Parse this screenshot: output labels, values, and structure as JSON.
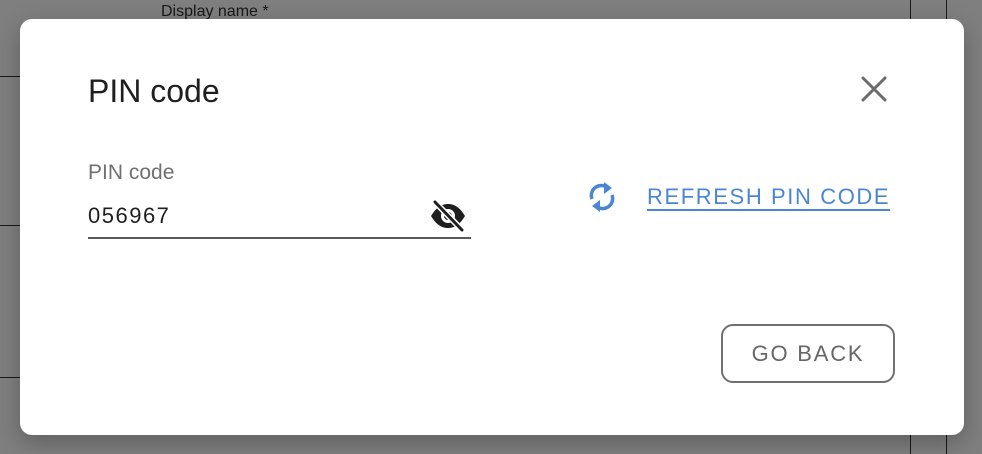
{
  "background": {
    "field_label": "Display name *"
  },
  "dialog": {
    "title": "PIN code",
    "close_icon": "close-icon",
    "pin_field": {
      "label": "PIN code",
      "value": "056967",
      "visibility_icon": "eye-off-icon"
    },
    "refresh": {
      "icon": "refresh-icon",
      "label": "REFRESH PIN CODE"
    },
    "go_back_label": "GO BACK"
  },
  "colors": {
    "accent": "#4a86d4",
    "text_primary": "#1f1f1f",
    "text_secondary": "#707070",
    "scrim": "#7a7a7a"
  }
}
